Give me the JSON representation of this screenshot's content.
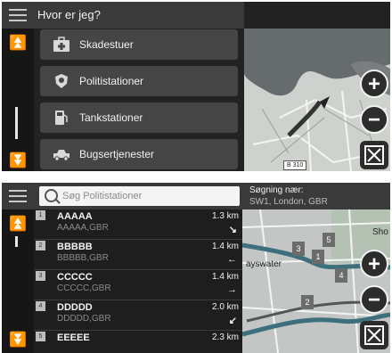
{
  "screen1": {
    "title": "Hvor er jeg?",
    "categories": [
      {
        "label": "Skadestuer",
        "icon": "first-aid-kit-icon"
      },
      {
        "label": "Politistationer",
        "icon": "police-badge-icon"
      },
      {
        "label": "Tankstationer",
        "icon": "fuel-pump-icon"
      },
      {
        "label": "Bugsertjenester",
        "icon": "tow-truck-icon"
      }
    ],
    "map": {
      "road_label": "B 310",
      "zoom_in": "+",
      "zoom_out": "−",
      "expand_icon": "expand-arrows-icon"
    }
  },
  "screen2": {
    "search": {
      "placeholder": "Søg Politistationer"
    },
    "near": {
      "caption": "Søgning nær:",
      "location": "SW1, London, GBR"
    },
    "results": [
      {
        "num": "1",
        "name": "AAAAA",
        "sub": "AAAAA,GBR",
        "dist": "1.3 km",
        "arrow": "↘"
      },
      {
        "num": "2",
        "name": "BBBBB",
        "sub": "BBBBB,GBR",
        "dist": "1.4 km",
        "arrow": "←"
      },
      {
        "num": "3",
        "name": "CCCCC",
        "sub": "CCCCC,GBR",
        "dist": "1.4 km",
        "arrow": "→"
      },
      {
        "num": "4",
        "name": "DDDDD",
        "sub": "DDDDD,GBR",
        "dist": "2.0 km",
        "arrow": "↙"
      },
      {
        "num": "5",
        "name": "EEEEE",
        "sub": "",
        "dist": "2.3 km",
        "arrow": ""
      }
    ],
    "map": {
      "place_label": "ayswater",
      "place_label_2": "Sho",
      "pins": [
        "1",
        "2",
        "3",
        "4",
        "5"
      ],
      "zoom_in": "+",
      "zoom_out": "−"
    }
  },
  "colors": {
    "header": "#3a3a3a",
    "button": "#454545",
    "map_water": "#666b6e",
    "route": "#3e6f7d"
  }
}
